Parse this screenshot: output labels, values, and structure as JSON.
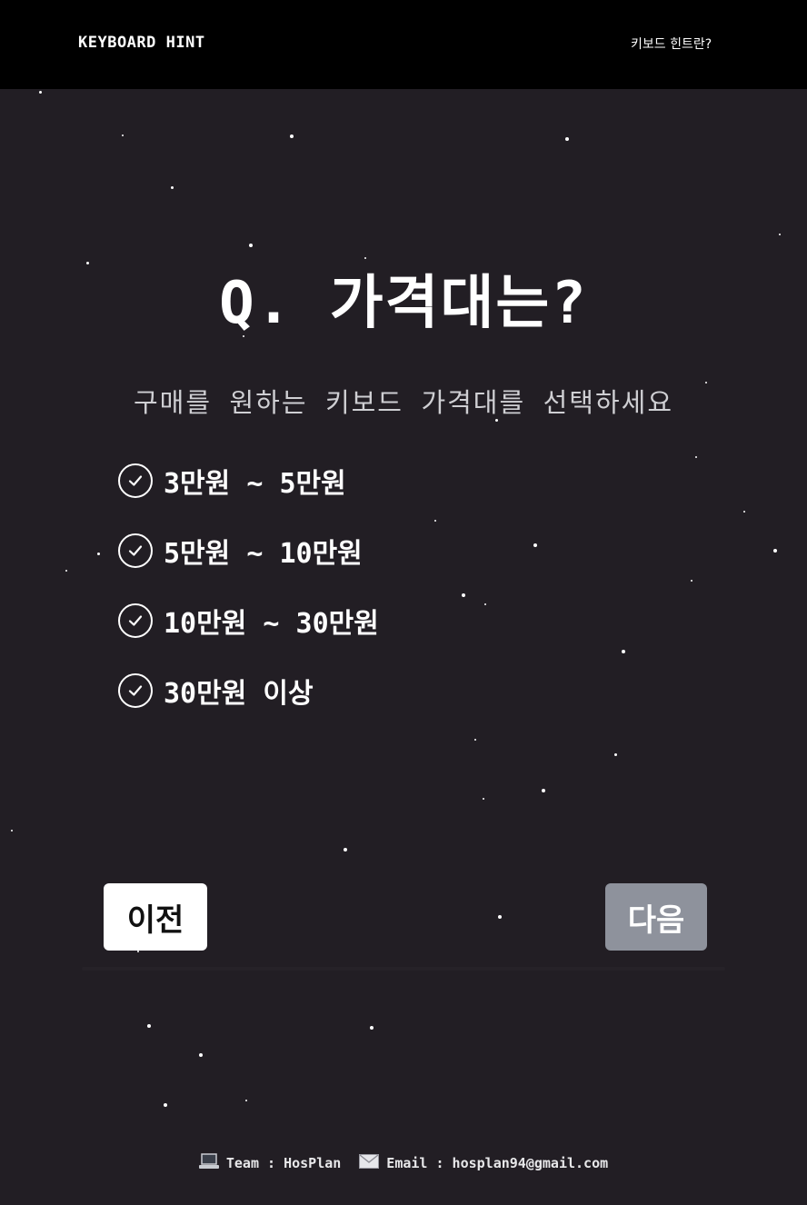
{
  "header": {
    "brand": "KEYBOARD HINT",
    "nav_link": "키보드 힌트란?"
  },
  "quiz": {
    "question": "Q. 가격대는?",
    "subtitle": "구매를 원하는 키보드 가격대를 선택하세요",
    "options": [
      {
        "label": "3만원 ~ 5만원",
        "icon": "check-circle-icon"
      },
      {
        "label": "5만원 ~ 10만원",
        "icon": "check-circle-icon"
      },
      {
        "label": "10만원 ~ 30만원",
        "icon": "check-circle-icon"
      },
      {
        "label": "30만원 이상",
        "icon": "check-circle-icon"
      }
    ]
  },
  "buttons": {
    "prev_label": "이전",
    "next_label": "다음"
  },
  "footer": {
    "team_icon": "laptop-icon",
    "team_text": "Team : HosPlan",
    "email_icon": "envelope-icon",
    "email_text": "Email : hosplan94@gmail.com"
  },
  "colors": {
    "background": "#221e24",
    "header": "#000000",
    "prev_button": "#ffffff",
    "next_button": "#8e929c"
  }
}
